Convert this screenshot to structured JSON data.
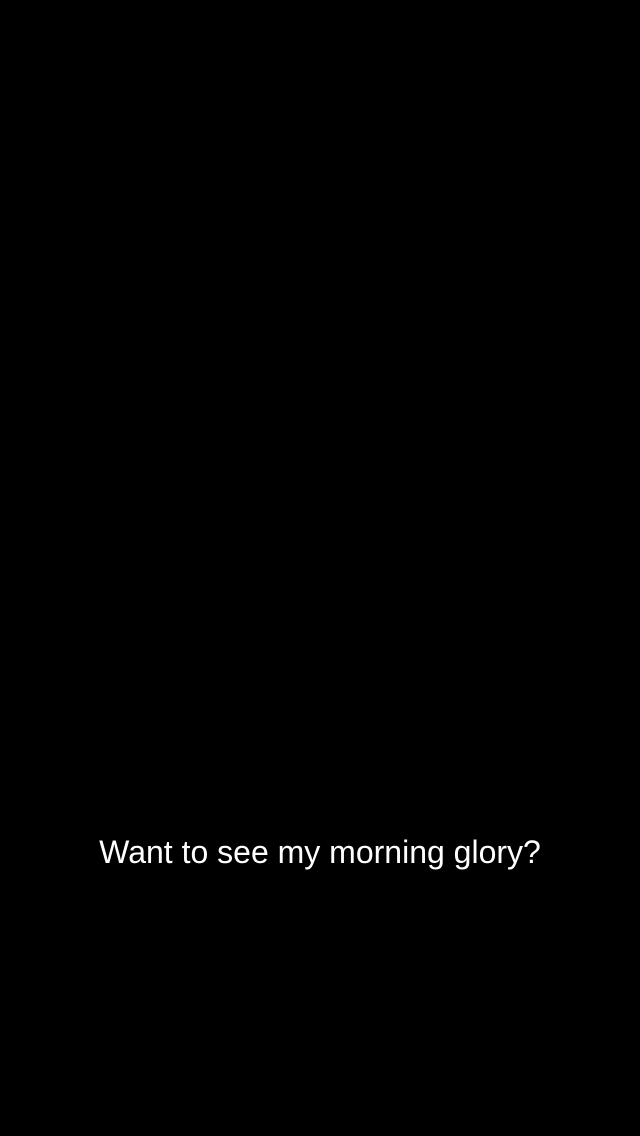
{
  "snap": {
    "background_color": "#000000",
    "caption": {
      "text": "Want to see my morning glory?",
      "color": "#ffffff"
    }
  }
}
